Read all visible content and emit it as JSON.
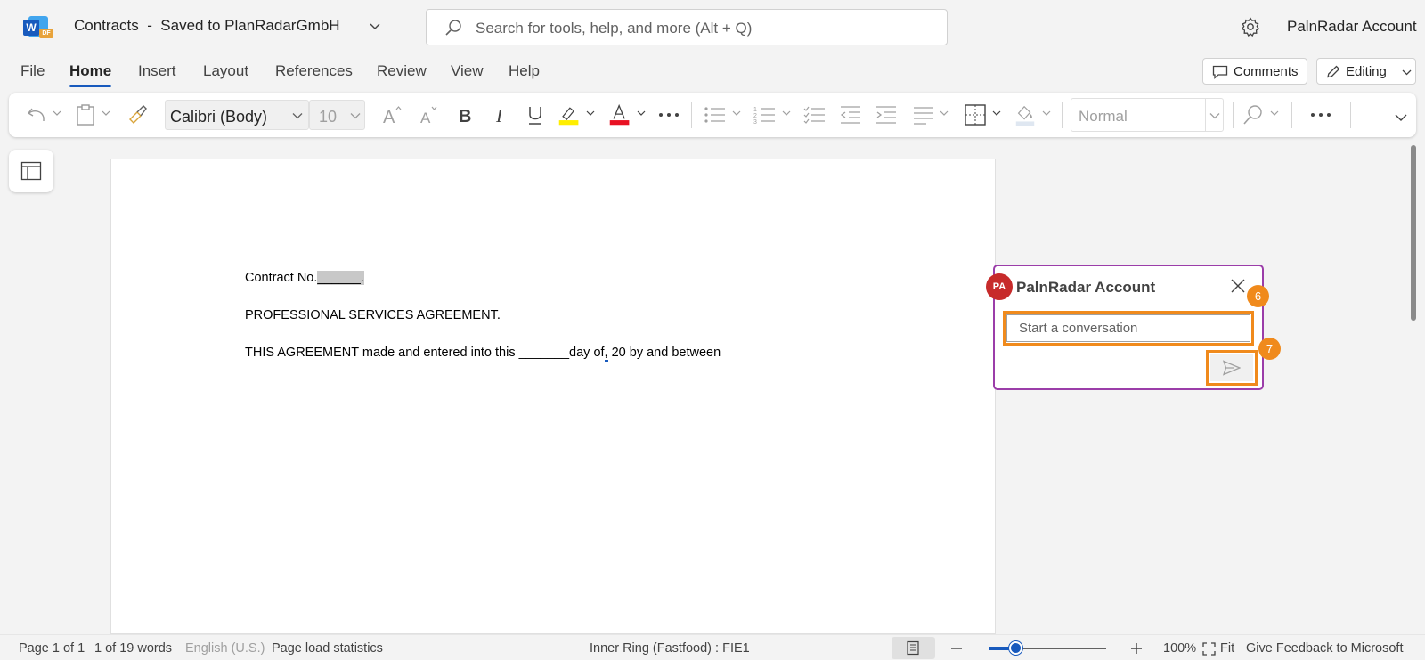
{
  "app": {
    "logo_letter": "W",
    "logo_badge": "DF",
    "title": "Contracts  -  Saved to PlanRadarGmbH",
    "search_placeholder": "Search for tools, help, and more (Alt + Q)",
    "account_name": "PalnRadar Account"
  },
  "menu": {
    "tabs": [
      "File",
      "Home",
      "Insert",
      "Layout",
      "References",
      "Review",
      "View",
      "Help"
    ],
    "active_tab": "Home",
    "comments_label": "Comments",
    "editing_label": "Editing"
  },
  "ribbon": {
    "font_name": "Calibri (Body)",
    "font_size": "10",
    "style_name": "Normal",
    "highlight_color": "#ffee00",
    "font_color": "#e81123"
  },
  "document": {
    "line1_prefix": "Contract No.",
    "line1_field": "______.",
    "line2": "PROFESSIONAL SERVICES AGREEMENT.",
    "line3_a": "THIS AGREEMENT made and entered into this _______day of",
    "line3_b": ",",
    "line3_c": " 20 by and between"
  },
  "comment": {
    "avatar_initials": "PA",
    "author": "PalnRadar Account",
    "input_placeholder": "Start a conversation",
    "badge_input": "6",
    "badge_send": "7",
    "border_color": "#9b3da9",
    "highlight_color": "#f08a1c"
  },
  "status": {
    "page": "Page 1 of 1",
    "words": "1 of 19 words",
    "language": "English (U.S.)",
    "page_load": "Page load statistics",
    "ring": "Inner Ring (Fastfood) : FIE1",
    "zoom": "100%",
    "fit": "Fit",
    "feedback": "Give Feedback to Microsoft"
  }
}
